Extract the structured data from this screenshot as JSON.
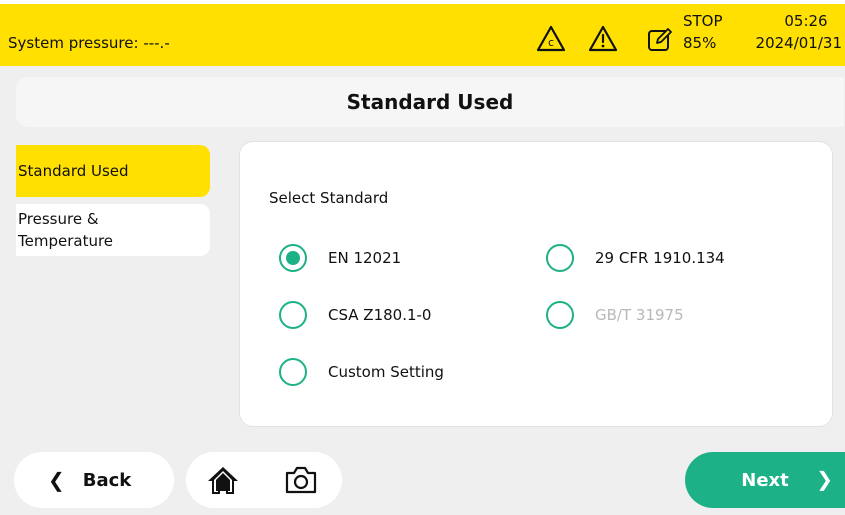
{
  "status": {
    "system_pressure": "System pressure: ---.-",
    "stop_label": "STOP",
    "percent": "85%",
    "time": "05:26",
    "date": "2024/01/31",
    "icons": [
      "c-warning-triangle-icon",
      "warning-triangle-icon",
      "edit-icon"
    ]
  },
  "header": {
    "title": "Standard Used"
  },
  "sidebar": {
    "items": [
      {
        "label": "Standard Used",
        "active": true
      },
      {
        "label": "Pressure & Temperature",
        "line1": "Pressure &",
        "line2": "Temperature",
        "active": false
      }
    ]
  },
  "panel": {
    "title": "Select Standard",
    "options": [
      {
        "label": "EN 12021",
        "checked": true,
        "disabled": false
      },
      {
        "label": "29 CFR 1910.134",
        "checked": false,
        "disabled": false
      },
      {
        "label": "CSA Z180.1-0",
        "checked": false,
        "disabled": false
      },
      {
        "label": "GB/T 31975",
        "checked": false,
        "disabled": true
      },
      {
        "label": "Custom Setting",
        "checked": false,
        "disabled": false
      }
    ]
  },
  "footer": {
    "back_label": "Back",
    "next_label": "Next",
    "icons": [
      "home-icon",
      "camera-icon"
    ]
  },
  "colors": {
    "accent_yellow": "#ffe000",
    "accent_green": "#1db188"
  }
}
